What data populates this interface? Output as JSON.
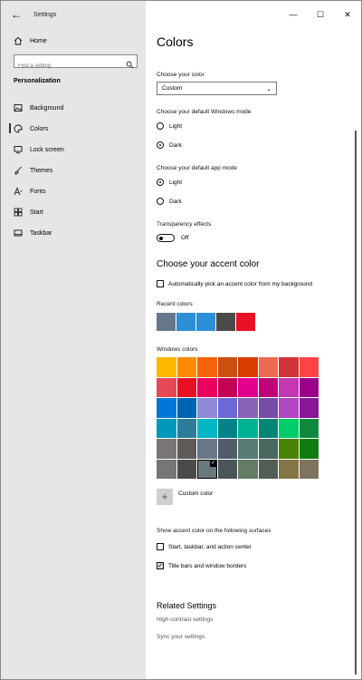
{
  "window": {
    "title": "Settings"
  },
  "sidebar": {
    "home_label": "Home",
    "search_placeholder": "Find a setting",
    "section_title": "Personalization",
    "items": [
      {
        "label": "Background",
        "icon": "picture-icon"
      },
      {
        "label": "Colors",
        "icon": "palette-icon",
        "selected": true
      },
      {
        "label": "Lock screen",
        "icon": "monitor-icon"
      },
      {
        "label": "Themes",
        "icon": "brush-icon"
      },
      {
        "label": "Fonts",
        "icon": "font-icon"
      },
      {
        "label": "Start",
        "icon": "start-icon"
      },
      {
        "label": "Taskbar",
        "icon": "taskbar-icon"
      }
    ]
  },
  "main": {
    "title": "Colors",
    "choose_color_label": "Choose your color",
    "choose_color_value": "Custom",
    "windows_mode_label": "Choose your default Windows mode",
    "windows_mode_options": [
      "Light",
      "Dark"
    ],
    "windows_mode_selected": "Dark",
    "app_mode_label": "Choose your default app mode",
    "app_mode_options": [
      "Light",
      "Dark"
    ],
    "app_mode_selected": "Light",
    "transparency_label": "Transparency effects",
    "transparency_state": "Off",
    "accent_heading": "Choose your accent color",
    "auto_pick_label": "Automatically pick an accent color from my background",
    "recent_colors_label": "Recent colors",
    "recent_colors": [
      "#68768a",
      "#2d8fd5",
      "#2b90d9",
      "#4c4a48",
      "#e81123"
    ],
    "windows_colors_label": "Windows colors",
    "windows_colors": [
      "#ffb900",
      "#ff8c00",
      "#f7630c",
      "#ca5010",
      "#da3b01",
      "#ef6950",
      "#d13438",
      "#ff4343",
      "#e74856",
      "#e81123",
      "#ea005e",
      "#c30052",
      "#e3008c",
      "#bf0077",
      "#c239b3",
      "#9a0089",
      "#0078d7",
      "#0063b1",
      "#8e8cd8",
      "#6b69d6",
      "#8764b8",
      "#744da9",
      "#b146c2",
      "#881798",
      "#0099bc",
      "#2d7d9a",
      "#00b7c3",
      "#038387",
      "#00b294",
      "#018574",
      "#00cc6a",
      "#10893e",
      "#7a7574",
      "#5d5a58",
      "#68768a",
      "#515c6b",
      "#567c73",
      "#486860",
      "#498205",
      "#107c10",
      "#767676",
      "#4c4a48",
      "#69797e",
      "#4a5459",
      "#647c64",
      "#525e54",
      "#847545",
      "#7e735f"
    ],
    "selected_color_index": 42,
    "custom_color_label": "Custom color",
    "surfaces_label": "Show accent color on the following surfaces",
    "surface_start_label": "Start, taskbar, and action center",
    "surface_start_checked": false,
    "surface_titlebars_label": "Title bars and window borders",
    "surface_titlebars_checked": true,
    "related_heading": "Related Settings",
    "related_links": [
      "High contrast settings",
      "Sync your settings"
    ]
  }
}
